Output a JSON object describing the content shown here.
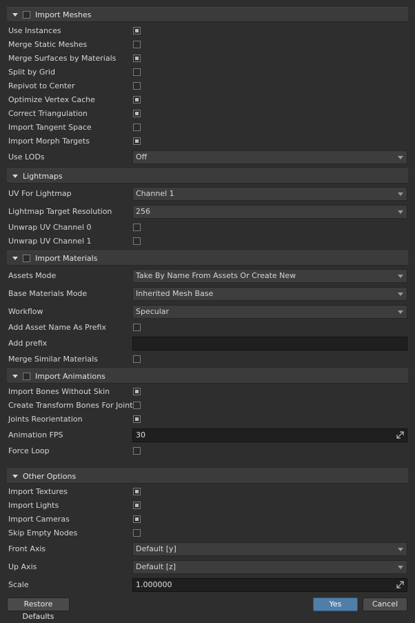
{
  "sections": {
    "meshes": {
      "title": "Import Meshes",
      "checked": false
    },
    "lightmaps": {
      "title": "Lightmaps"
    },
    "materials": {
      "title": "Import Materials",
      "checked": false
    },
    "animations": {
      "title": "Import Animations",
      "checked": false
    },
    "other": {
      "title": "Other Options"
    }
  },
  "meshes": {
    "use_instances": {
      "label": "Use Instances",
      "checked": true
    },
    "merge_static": {
      "label": "Merge Static Meshes",
      "checked": false
    },
    "merge_surfaces": {
      "label": "Merge Surfaces by Materials",
      "checked": true
    },
    "split_grid": {
      "label": "Split by Grid",
      "checked": false
    },
    "repivot": {
      "label": "Repivot to Center",
      "checked": false
    },
    "optimize_cache": {
      "label": "Optimize Vertex Cache",
      "checked": true
    },
    "correct_tri": {
      "label": "Correct Triangulation",
      "checked": true
    },
    "tangent": {
      "label": "Import Tangent Space",
      "checked": false
    },
    "morph": {
      "label": "Import Morph Targets",
      "checked": true
    },
    "use_lods": {
      "label": "Use LODs",
      "value": "Off"
    }
  },
  "lightmaps": {
    "uv": {
      "label": "UV For Lightmap",
      "value": "Channel 1"
    },
    "resolution": {
      "label": "Lightmap Target Resolution",
      "value": "256"
    },
    "unwrap0": {
      "label": "Unwrap UV Channel 0",
      "checked": false
    },
    "unwrap1": {
      "label": "Unwrap UV Channel 1",
      "checked": false
    }
  },
  "materials": {
    "assets_mode": {
      "label": "Assets Mode",
      "value": "Take By Name From Assets Or Create New"
    },
    "base_mode": {
      "label": "Base Materials Mode",
      "value": "Inherited Mesh Base"
    },
    "workflow": {
      "label": "Workflow",
      "value": "Specular"
    },
    "prefix_toggle": {
      "label": "Add Asset Name As Prefix",
      "checked": false
    },
    "add_prefix": {
      "label": "Add prefix",
      "value": ""
    },
    "merge_similar": {
      "label": "Merge Similar Materials",
      "checked": false
    }
  },
  "animations": {
    "bones_no_skin": {
      "label": "Import Bones Without Skin",
      "checked": true
    },
    "transform_bones": {
      "label": "Create Transform Bones For Joints",
      "checked": false
    },
    "reorient": {
      "label": "Joints Reorientation",
      "checked": true
    },
    "fps": {
      "label": "Animation FPS",
      "value": "30"
    },
    "force_loop": {
      "label": "Force Loop",
      "checked": false
    }
  },
  "other": {
    "textures": {
      "label": "Import Textures",
      "checked": true
    },
    "lights": {
      "label": "Import Lights",
      "checked": true
    },
    "cameras": {
      "label": "Import Cameras",
      "checked": true
    },
    "skip_empty": {
      "label": "Skip Empty Nodes",
      "checked": false
    },
    "front_axis": {
      "label": "Front Axis",
      "value": "Default [y]"
    },
    "up_axis": {
      "label": "Up Axis",
      "value": "Default [z]"
    },
    "scale": {
      "label": "Scale",
      "value": "1.000000"
    }
  },
  "footer": {
    "restore_label": "Restore Defaults",
    "yes_label": "Yes",
    "cancel_label": "Cancel"
  },
  "colors": {
    "primary_button": "#4f7ea8",
    "background": "#2e2e2e"
  }
}
